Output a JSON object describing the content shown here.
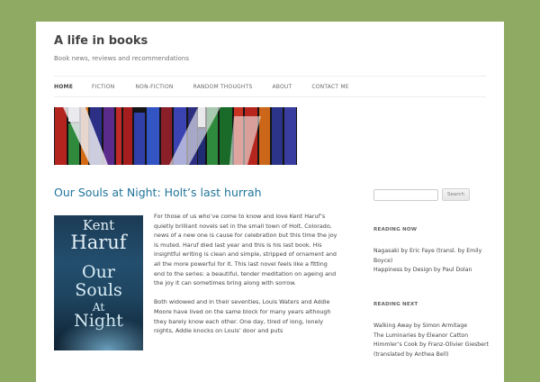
{
  "site": {
    "title": "A life in books",
    "description": "Book news, reviews and recommendations"
  },
  "nav": {
    "items": [
      "HOME",
      "FICTION",
      "NON-FICTION",
      "RANDOM THOUGHTS",
      "ABOUT",
      "CONTACT ME"
    ],
    "current": "HOME"
  },
  "post": {
    "title": "Our Souls at Night: Holt’s last hurrah",
    "cover": {
      "author_first": "Kent",
      "author_last": "Haruf",
      "title_line1": "Our",
      "title_line2": "Souls",
      "title_line3": "At",
      "title_line4": "Night"
    },
    "paragraphs": [
      "For those of us who’ve come to know and love Kent Haruf’s quietly brilliant novels set in the small town of Holt, Colorado, news of a new one is cause for celebration but this time the joy is muted. Haruf died last year and this is his last book. His insightful writing is clean and simple, stripped of ornament and all the more powerful for it. This last novel feels like a fitting end to the series: a beautiful, tender meditation on ageing and the joy it can sometimes bring along with sorrow.",
      "Both widowed and in their seventies, Louis Waters and Addie Moore have lived on the same block for many years although they barely know each other. One day, tired of long, lonely nights, Addie knocks on Louis’ door and puts"
    ]
  },
  "sidebar": {
    "search": {
      "placeholder": "",
      "button_label": "Search"
    },
    "reading_now": {
      "title": "READING NOW",
      "items": [
        "Nagasaki by Eric Faye (transl. by Emily Boyce)",
        "Happiness by Design by Paul Dolan"
      ]
    },
    "reading_next": {
      "title": "READING NEXT",
      "items": [
        "Walking Away by Simon Armitage",
        "The Luminaries by Eleanor Catton",
        "Himmler’s Cook by Franz-Olivier Giesbert (translated by Anthea Bell)"
      ]
    }
  },
  "colors": {
    "background": "#8faa63",
    "link": "#21759b",
    "text": "#444444"
  }
}
